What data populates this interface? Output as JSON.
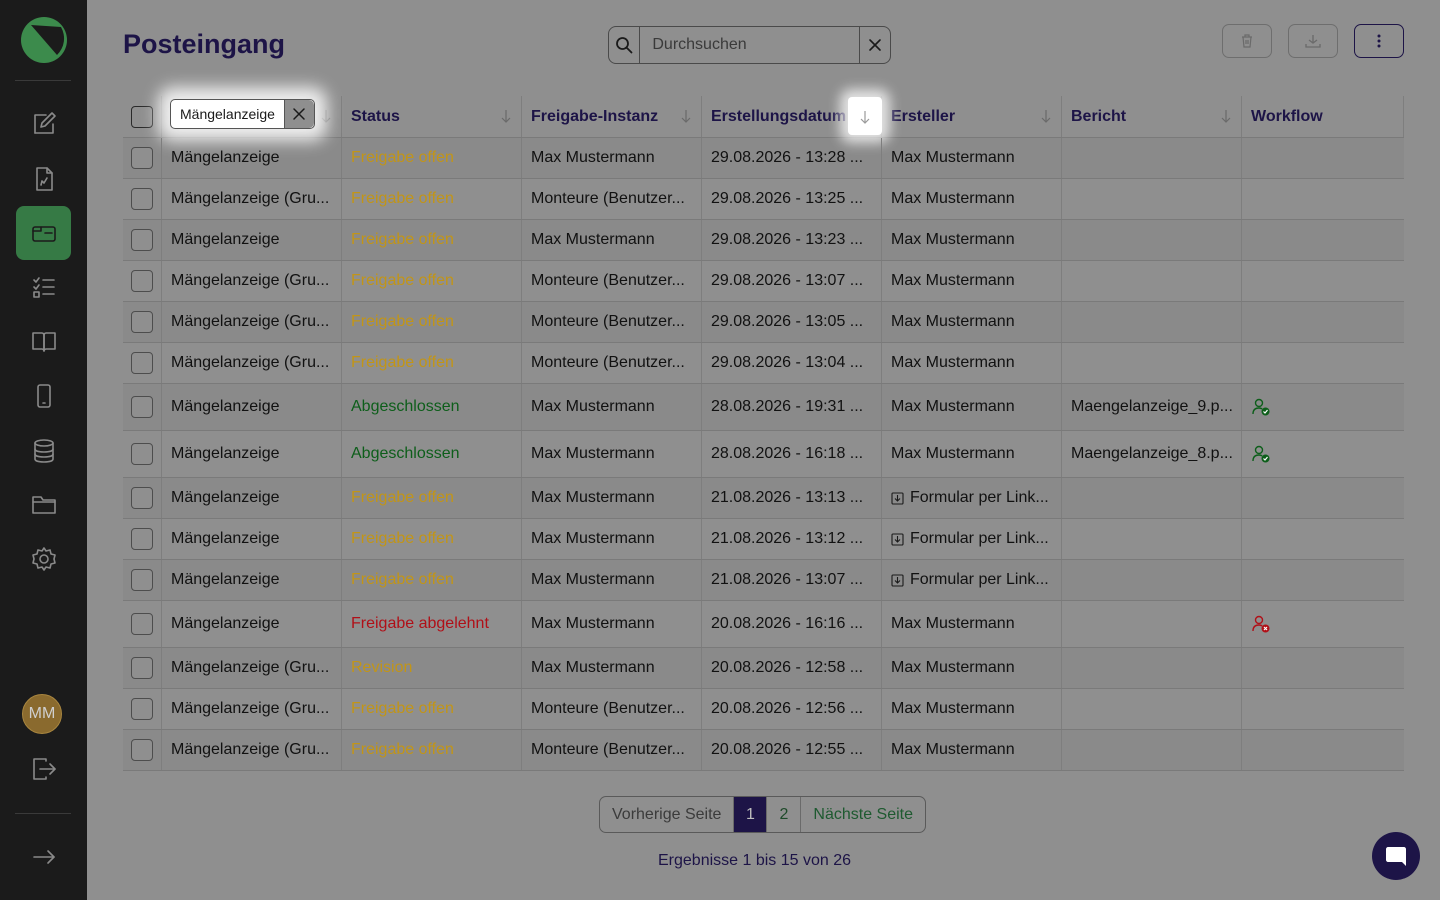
{
  "page": {
    "title": "Posteingang"
  },
  "search": {
    "placeholder": "Durchsuchen"
  },
  "sidebar": {
    "avatar_initials": "MM",
    "items": [
      {
        "name": "edit-icon"
      },
      {
        "name": "document-icon"
      },
      {
        "name": "inbox-icon",
        "active": true
      },
      {
        "name": "checklist-icon"
      },
      {
        "name": "book-icon"
      },
      {
        "name": "mobile-icon"
      },
      {
        "name": "database-icon"
      },
      {
        "name": "folder-icon"
      },
      {
        "name": "gear-icon"
      }
    ]
  },
  "table": {
    "filter_chip": "Mängelanzeige",
    "headers": [
      "Status",
      "Freigabe-Instanz",
      "Erstellungsdatum",
      "Ersteller",
      "Bericht",
      "Workflow"
    ],
    "rows": [
      {
        "form": "Mängelanzeige",
        "status": "Freigabe offen",
        "status_type": "open",
        "instance": "Max Mustermann",
        "date": "29.08.2026 - 13:28 ...",
        "creator": "Max Mustermann",
        "report": "",
        "workflow": ""
      },
      {
        "form": "Mängelanzeige (Gru...",
        "status": "Freigabe offen",
        "status_type": "open",
        "instance": "Monteure (Benutzer...",
        "date": "29.08.2026 - 13:25 ...",
        "creator": "Max Mustermann",
        "report": "",
        "workflow": ""
      },
      {
        "form": "Mängelanzeige",
        "status": "Freigabe offen",
        "status_type": "open",
        "instance": "Max Mustermann",
        "date": "29.08.2026 - 13:23 ...",
        "creator": "Max Mustermann",
        "report": "",
        "workflow": ""
      },
      {
        "form": "Mängelanzeige (Gru...",
        "status": "Freigabe offen",
        "status_type": "open",
        "instance": "Monteure (Benutzer...",
        "date": "29.08.2026 - 13:07 ...",
        "creator": "Max Mustermann",
        "report": "",
        "workflow": ""
      },
      {
        "form": "Mängelanzeige (Gru...",
        "status": "Freigabe offen",
        "status_type": "open",
        "instance": "Monteure (Benutzer...",
        "date": "29.08.2026 - 13:05 ...",
        "creator": "Max Mustermann",
        "report": "",
        "workflow": ""
      },
      {
        "form": "Mängelanzeige (Gru...",
        "status": "Freigabe offen",
        "status_type": "open",
        "instance": "Monteure (Benutzer...",
        "date": "29.08.2026 - 13:04 ...",
        "creator": "Max Mustermann",
        "report": "",
        "workflow": ""
      },
      {
        "form": "Mängelanzeige",
        "status": "Abgeschlossen",
        "status_type": "done",
        "instance": "Max Mustermann",
        "date": "28.08.2026 - 19:31 ...",
        "creator": "Max Mustermann",
        "report": "Maengelanzeige_9.p...",
        "workflow": "user-approved-icon"
      },
      {
        "form": "Mängelanzeige",
        "status": "Abgeschlossen",
        "status_type": "done",
        "instance": "Max Mustermann",
        "date": "28.08.2026 - 16:18 ...",
        "creator": "Max Mustermann",
        "report": "Maengelanzeige_8.p...",
        "workflow": "user-approved-icon"
      },
      {
        "form": "Mängelanzeige",
        "status": "Freigabe offen",
        "status_type": "open",
        "instance": "Max Mustermann",
        "date": "21.08.2026 - 13:13 ...",
        "creator": "Formular per Link...",
        "creator_icon": "link-download-icon",
        "report": "",
        "workflow": ""
      },
      {
        "form": "Mängelanzeige",
        "status": "Freigabe offen",
        "status_type": "open",
        "instance": "Max Mustermann",
        "date": "21.08.2026 - 13:12 ...",
        "creator": "Formular per Link...",
        "creator_icon": "link-download-icon",
        "report": "",
        "workflow": ""
      },
      {
        "form": "Mängelanzeige",
        "status": "Freigabe offen",
        "status_type": "open",
        "instance": "Max Mustermann",
        "date": "21.08.2026 - 13:07 ...",
        "creator": "Formular per Link...",
        "creator_icon": "link-download-icon",
        "report": "",
        "workflow": ""
      },
      {
        "form": "Mängelanzeige",
        "status": "Freigabe abgelehnt",
        "status_type": "rejected",
        "instance": "Max Mustermann",
        "date": "20.08.2026 - 16:16 ...",
        "creator": "Max Mustermann",
        "report": "",
        "workflow": "user-rejected-icon"
      },
      {
        "form": "Mängelanzeige (Gru...",
        "status": "Revision",
        "status_type": "revision",
        "instance": "Max Mustermann",
        "date": "20.08.2026 - 12:58 ...",
        "creator": "Max Mustermann",
        "report": "",
        "workflow": ""
      },
      {
        "form": "Mängelanzeige (Gru...",
        "status": "Freigabe offen",
        "status_type": "open",
        "instance": "Monteure (Benutzer...",
        "date": "20.08.2026 - 12:56 ...",
        "creator": "Max Mustermann",
        "report": "",
        "workflow": ""
      },
      {
        "form": "Mängelanzeige (Gru...",
        "status": "Freigabe offen",
        "status_type": "open",
        "instance": "Monteure (Benutzer...",
        "date": "20.08.2026 - 12:55 ...",
        "creator": "Max Mustermann",
        "report": "",
        "workflow": ""
      }
    ]
  },
  "pagination": {
    "prev": "Vorherige Seite",
    "pages": [
      "1",
      "2"
    ],
    "current": "1",
    "next": "Nächste Seite",
    "results": "Ergebnisse 1 bis 15 von 26"
  },
  "colors": {
    "accent": "#367a45",
    "primary": "#1d1447",
    "open": "#c29517",
    "done": "#0d5e1a",
    "rejected": "#b01018"
  }
}
